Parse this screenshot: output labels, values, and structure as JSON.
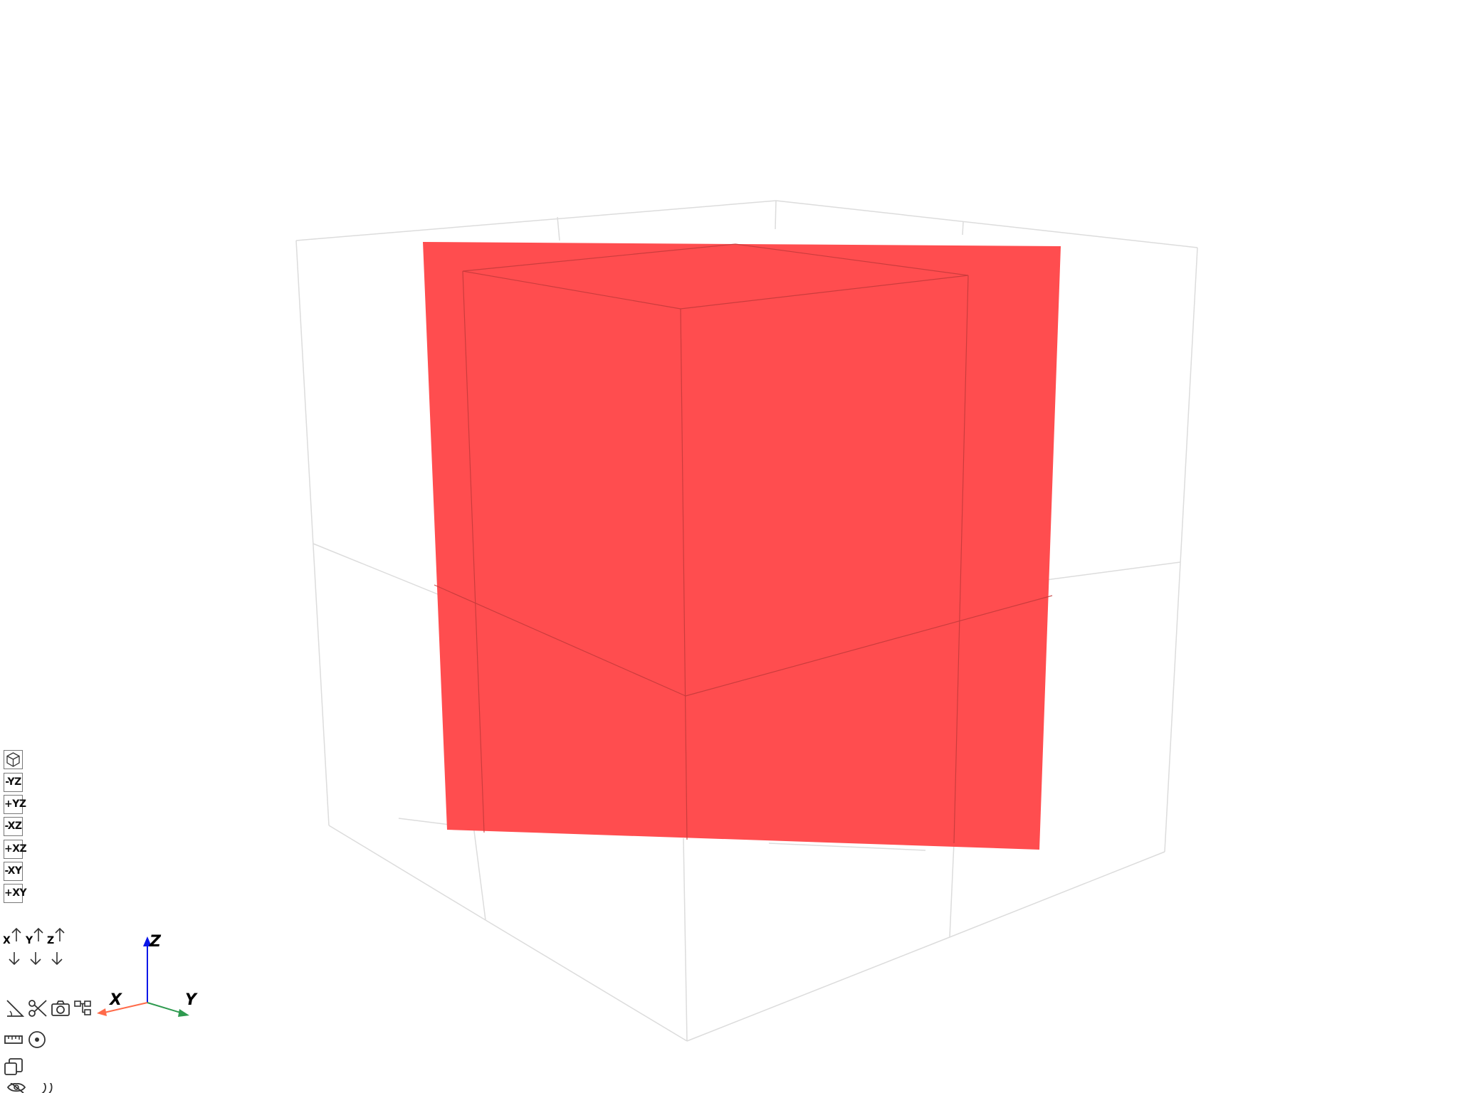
{
  "toolbar": {
    "views": [
      {
        "name": "iso-view-button",
        "label": ""
      },
      {
        "name": "view-minus-yz-button",
        "label": "-YZ"
      },
      {
        "name": "view-plus-yz-button",
        "label": "+YZ"
      },
      {
        "name": "view-minus-xz-button",
        "label": "-XZ"
      },
      {
        "name": "view-plus-xz-button",
        "label": "+XZ"
      },
      {
        "name": "view-minus-xy-button",
        "label": "-XY"
      },
      {
        "name": "view-plus-xy-button",
        "label": "+XY"
      }
    ],
    "axis_buttons": [
      "X",
      "Y",
      "Z"
    ],
    "tool_icons": [
      "measure-angle-icon",
      "scissors-icon",
      "camera-icon",
      "tree-icon",
      "ruler-icon",
      "target-icon",
      "layers-icon",
      "eye-off-icon",
      "moon-icon"
    ]
  },
  "triad": {
    "x_label": "X",
    "y_label": "Y",
    "z_label": "Z",
    "x_color": "#ff6b4a",
    "y_color": "#2e9a4f",
    "z_color": "#0b16e8"
  },
  "scene": {
    "face_color": "#ff4d4f",
    "grid_color": "#d9d9d9",
    "edge_color": "#b32a2a"
  }
}
